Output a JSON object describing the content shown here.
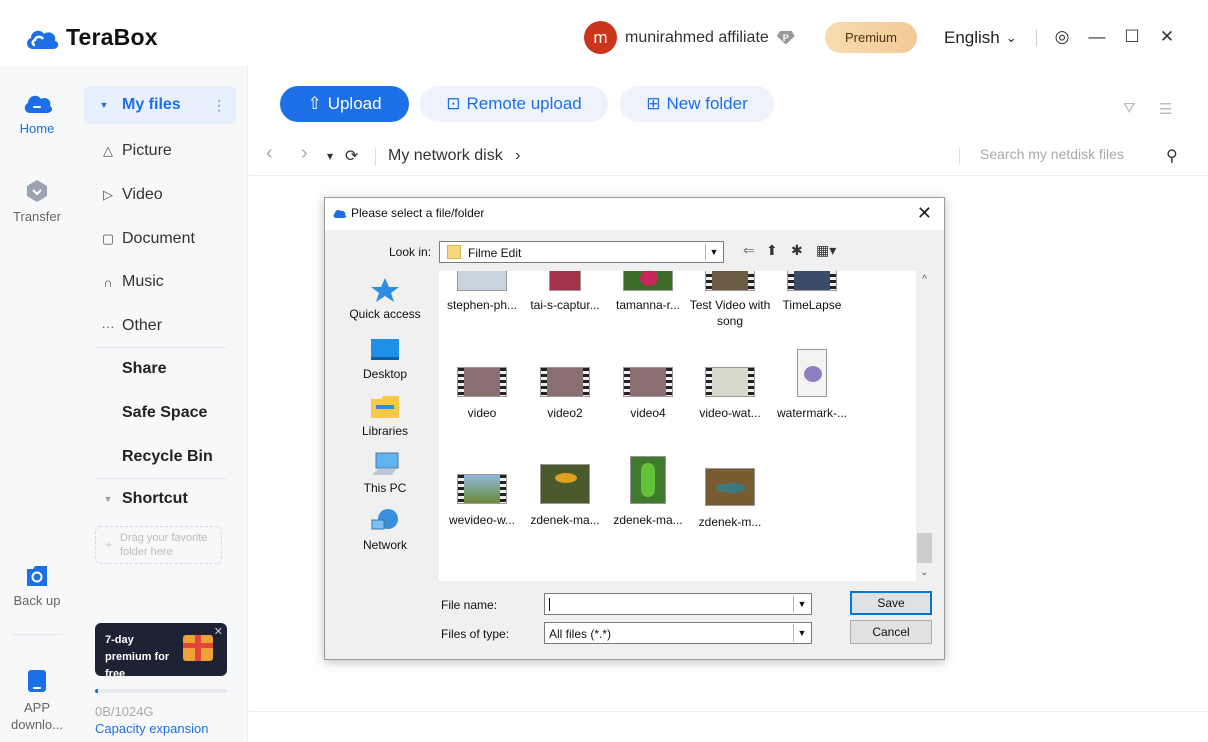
{
  "app": {
    "name": "TeraBox"
  },
  "titlebar": {
    "avatar_letter": "m",
    "username": "munirahmed affiliate",
    "user_badge": "P",
    "premium_label": "Premium",
    "language": "English",
    "language_caret": "⌄",
    "settings_icon": "◎",
    "minimize_icon": "—",
    "maximize_icon": "☐",
    "close_icon": "✕"
  },
  "rail": {
    "items": [
      {
        "label": "Home",
        "icon": "home-icon"
      },
      {
        "label": "Transfer",
        "icon": "transfer-icon"
      },
      {
        "label": "Back up",
        "icon": "backup-icon"
      },
      {
        "label": "APP downlo...",
        "icon": "app-download-icon"
      }
    ]
  },
  "sidebar": {
    "my_files": {
      "label": "My files",
      "caret": "▼",
      "more": "⋮"
    },
    "categories": [
      {
        "label": "Picture",
        "icon": "△"
      },
      {
        "label": "Video",
        "icon": "▷"
      },
      {
        "label": "Document",
        "icon": "▢"
      },
      {
        "label": "Music",
        "icon": "∩"
      },
      {
        "label": "Other",
        "icon": "···"
      }
    ],
    "sections": [
      "Share",
      "Safe Space",
      "Recycle Bin"
    ],
    "shortcut": {
      "label": "Shortcut",
      "caret": "▼"
    },
    "dropzone_text": "Drag your favorite folder here",
    "dropzone_plus": "+",
    "promo": {
      "text": "7-day premium for free",
      "close": "✕"
    },
    "capacity": {
      "used_text": "0B/1024G",
      "fraction": 0.01,
      "link": "Capacity expansion"
    }
  },
  "toolbar": {
    "upload_label": "Upload",
    "upload_icon": "⇧",
    "remote_upload_label": "Remote upload",
    "remote_upload_icon": "⊡",
    "new_folder_label": "New folder",
    "new_folder_icon": "⊞",
    "filter_icon": "⛛",
    "list_icon": "☰"
  },
  "pathbar": {
    "back_icon": "‹",
    "forward_icon": "›",
    "dropdown_icon": "▾",
    "refresh_icon": "⟳",
    "path": "My network disk",
    "path_caret": "›",
    "search_placeholder": "Search my netdisk files",
    "search_icon": "⚲"
  },
  "dialog": {
    "title": "Please select a file/folder",
    "close": "✕",
    "look_in_label": "Look in:",
    "look_in_value": "Filme Edit",
    "dd_arrow": "▼",
    "tools": {
      "back": "⇐",
      "up": "⬆",
      "new_folder": "✱",
      "view": "▦▾"
    },
    "places": [
      "Quick access",
      "Desktop",
      "Libraries",
      "This PC",
      "Network"
    ],
    "files": [
      {
        "name": "stephen-ph...",
        "kind": "image",
        "color": "#c9d4de"
      },
      {
        "name": "tai-s-captur...",
        "kind": "image",
        "color": "#a3344b"
      },
      {
        "name": "tamanna-r...",
        "kind": "image",
        "color": "#c6285e"
      },
      {
        "name": "Test Video with song",
        "kind": "video",
        "color": "#6b5a44"
      },
      {
        "name": "TimeLapse",
        "kind": "video",
        "color": "#3b4a66"
      },
      {
        "name": "video",
        "kind": "video",
        "color": "#8a6f72"
      },
      {
        "name": "video2",
        "kind": "video",
        "color": "#8a6f72"
      },
      {
        "name": "video4",
        "kind": "video",
        "color": "#8a6f72"
      },
      {
        "name": "video-wat...",
        "kind": "video",
        "color": "#d8d8cc"
      },
      {
        "name": "watermark-...",
        "kind": "image",
        "color": "#8f7fbf"
      },
      {
        "name": "wevideo-w...",
        "kind": "video",
        "color": "#6a8a3a"
      },
      {
        "name": "zdenek-ma...",
        "kind": "image",
        "color": "#4a5a2a"
      },
      {
        "name": "zdenek-ma...",
        "kind": "image",
        "color": "#3f7a2e"
      },
      {
        "name": "zdenek-m...",
        "kind": "image",
        "color": "#7a5a30"
      }
    ],
    "scroll_up": "^",
    "scroll_down": "⌄",
    "file_name_label": "File name:",
    "file_name_value": "",
    "files_of_type_label": "Files of type:",
    "files_of_type_value": "All files (*.*)",
    "save_label": "Save",
    "cancel_label": "Cancel"
  },
  "colors": {
    "accent": "#1d6fe8",
    "premium": "#f2c995",
    "avatar": "#c9361c"
  }
}
